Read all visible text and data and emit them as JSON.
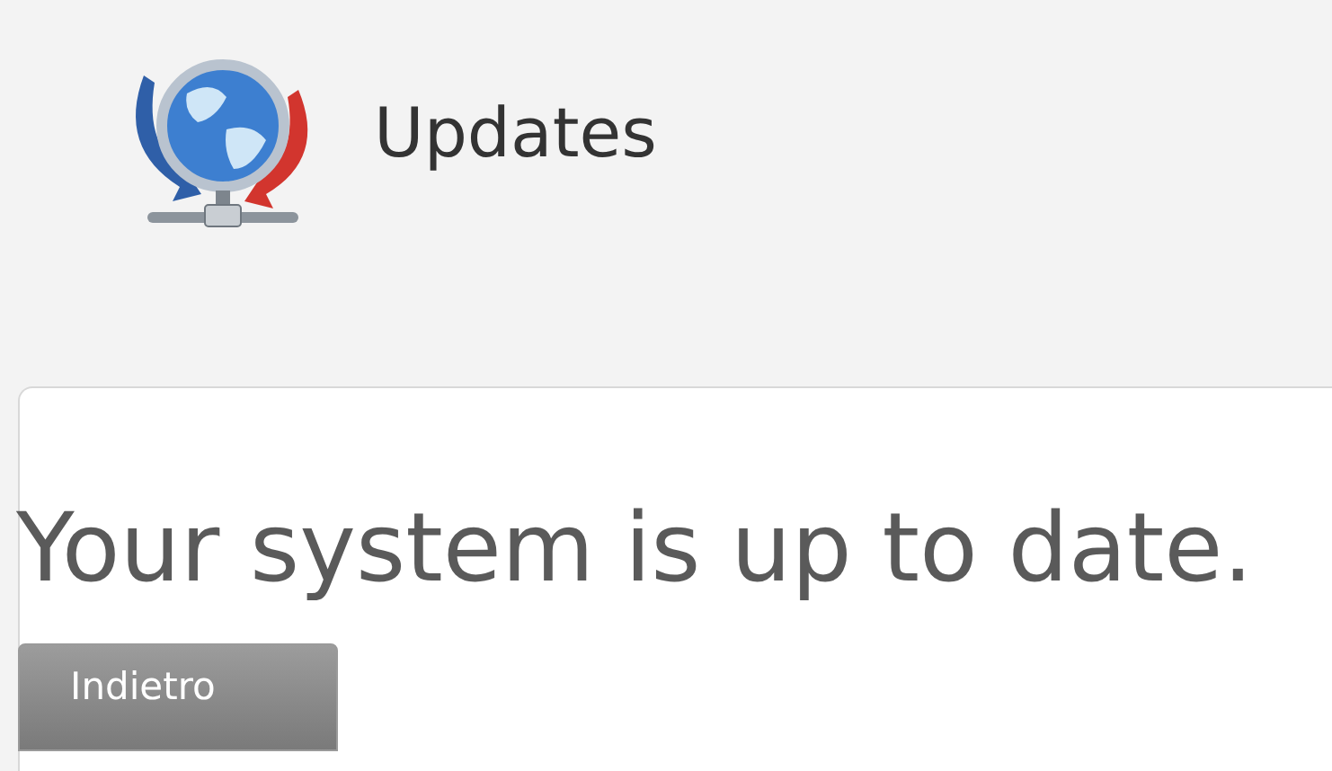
{
  "header": {
    "title": "Updates"
  },
  "message": "Your system is up to date.",
  "back_button": {
    "label": "Indietro",
    "disabled": true
  }
}
